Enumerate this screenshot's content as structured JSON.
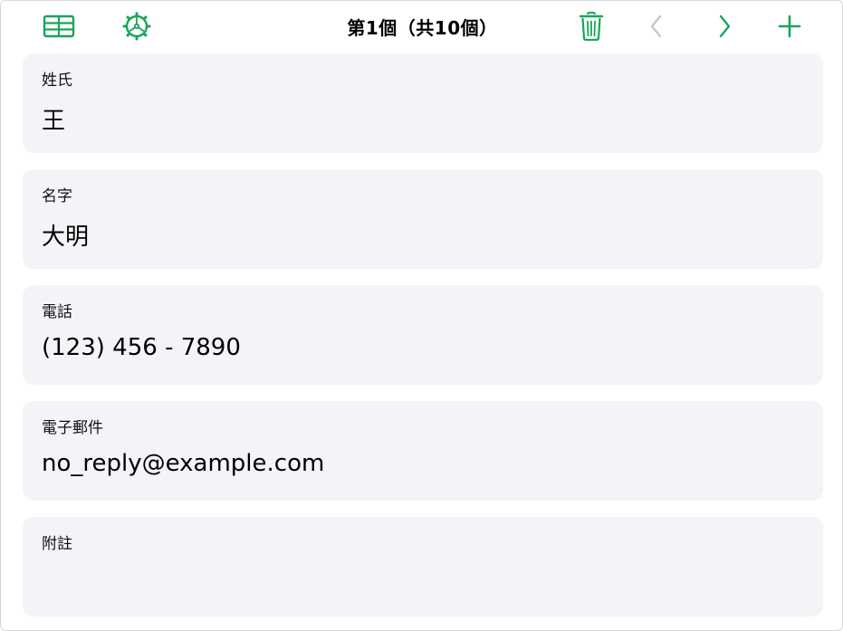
{
  "toolbar": {
    "title": "第1個（共10個）",
    "accent_color": "#1aa55a",
    "disabled_color": "#c7c7cc",
    "icons": {
      "table": "table-grid-icon",
      "settings": "record-settings-icon",
      "delete": "trash-icon",
      "previous": "chevron-left-icon",
      "next": "chevron-right-icon",
      "add": "plus-icon"
    }
  },
  "fields": [
    {
      "label": "姓氏",
      "value": "王"
    },
    {
      "label": "名字",
      "value": "大明"
    },
    {
      "label": "電話",
      "value": "(123) 456 - 7890"
    },
    {
      "label": "電子郵件",
      "value": "no_reply@example.com"
    },
    {
      "label": "附註",
      "value": ""
    }
  ]
}
